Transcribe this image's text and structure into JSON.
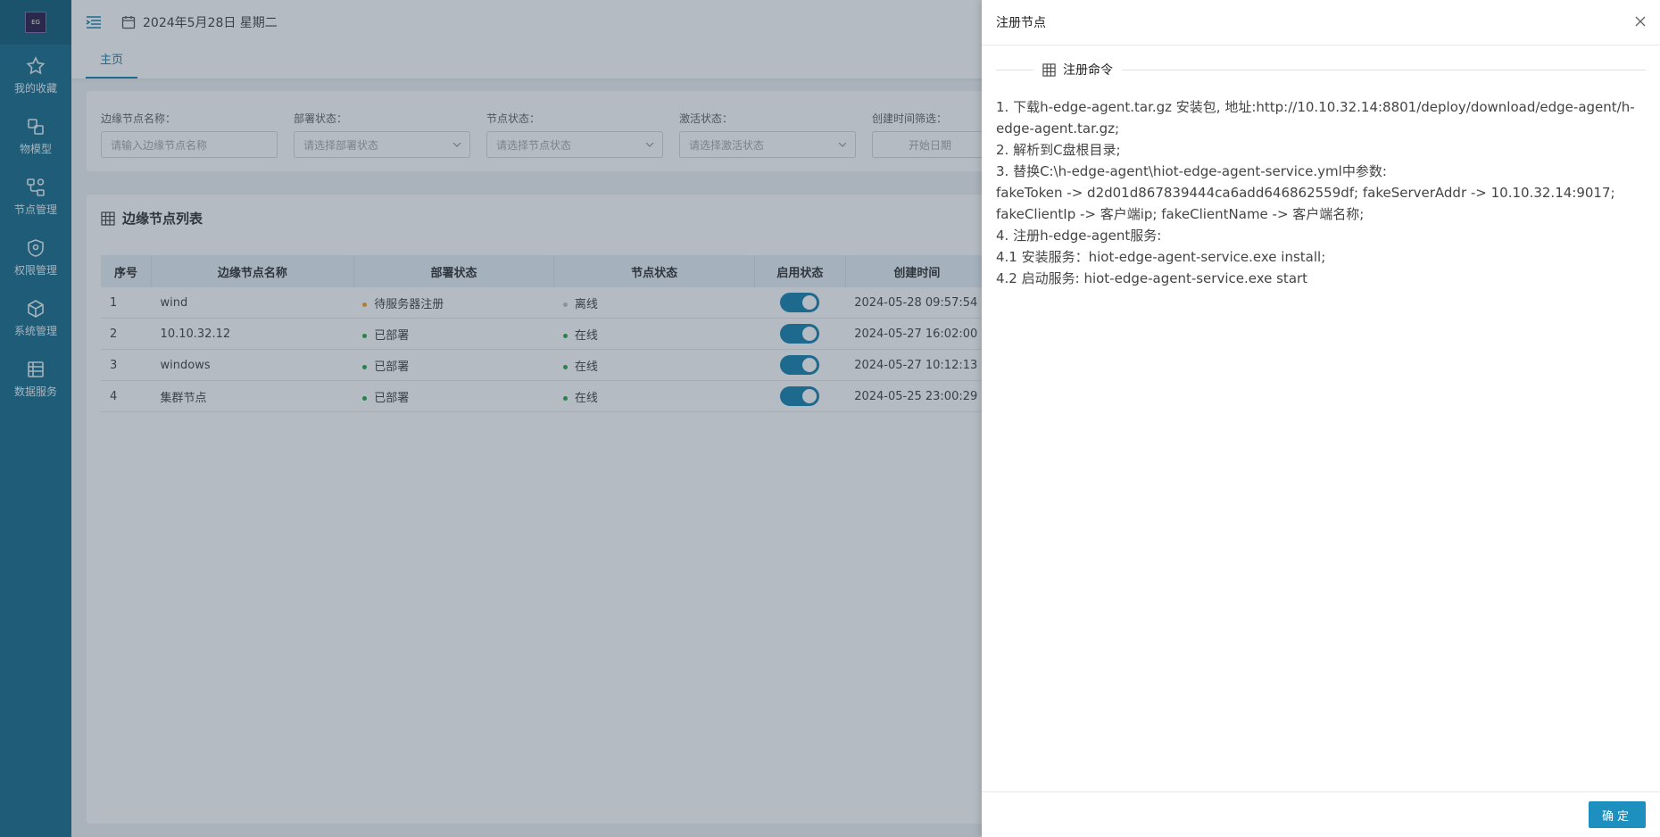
{
  "sidebar": {
    "logo_text": "EG",
    "items": [
      {
        "label": "我的收藏",
        "icon": "star-icon"
      },
      {
        "label": "物模型",
        "icon": "model-icon"
      },
      {
        "label": "节点管理",
        "icon": "node-icon"
      },
      {
        "label": "权限管理",
        "icon": "shield-icon"
      },
      {
        "label": "系统管理",
        "icon": "cube-icon"
      },
      {
        "label": "数据服务",
        "icon": "data-icon"
      }
    ]
  },
  "header": {
    "date": "2024年5月28日 星期二"
  },
  "tabs": [
    {
      "label": "主页"
    }
  ],
  "filters": {
    "name": {
      "label": "边缘节点名称：",
      "placeholder": "请输入边缘节点名称"
    },
    "deploy": {
      "label": "部署状态：",
      "placeholder": "请选择部署状态"
    },
    "node": {
      "label": "节点状态：",
      "placeholder": "请选择节点状态"
    },
    "activate": {
      "label": "激活状态：",
      "placeholder": "请选择激活状态"
    },
    "created": {
      "label": "创建时间筛选：",
      "placeholder": "开始日期"
    }
  },
  "table": {
    "title": "边缘节点列表",
    "columns": [
      "序号",
      "边缘节点名称",
      "部署状态",
      "节点状态",
      "启用状态",
      "创建时间"
    ],
    "rows": [
      {
        "index": "1",
        "name": "wind",
        "deploy": "待服务器注册",
        "node": "离线",
        "enabled": true,
        "created": "2024-05-28 09:57:54"
      },
      {
        "index": "2",
        "name": "10.10.32.12",
        "deploy": "已部署",
        "node": "在线",
        "enabled": true,
        "created": "2024-05-27 16:02:00"
      },
      {
        "index": "3",
        "name": "windows",
        "deploy": "已部署",
        "node": "在线",
        "enabled": true,
        "created": "2024-05-27 10:12:13"
      },
      {
        "index": "4",
        "name": "集群节点",
        "deploy": "已部署",
        "node": "在线",
        "enabled": true,
        "created": "2024-05-25 23:00:29"
      }
    ]
  },
  "drawer": {
    "title": "注册节点",
    "section": "注册命令",
    "lines": [
      "1. 下载h-edge-agent.tar.gz 安装包, 地址:http://10.10.32.14:8801/deploy/download/edge-agent/h-edge-agent.tar.gz;",
      "2. 解析到C盘根目录;",
      "3. 替换C:\\h-edge-agent\\hiot-edge-agent-service.yml中参数:",
      "fakeToken -> d2d01d867839444ca6add646862559df; fakeServerAddr -> 10.10.32.14:9017; fakeClientIp -> 客户端ip; fakeClientName -> 客户端名称;",
      "4. 注册h-edge-agent服务:",
      "4.1 安装服务：hiot-edge-agent-service.exe install;",
      "4.2 启动服务: hiot-edge-agent-service.exe start"
    ],
    "ok_label": "确定"
  },
  "colors": {
    "sidebar": "#1a6e8e",
    "primary": "#1d90c0",
    "online": "#2aa84a",
    "pending": "#f5a623",
    "offline": "#c0c0c0"
  }
}
